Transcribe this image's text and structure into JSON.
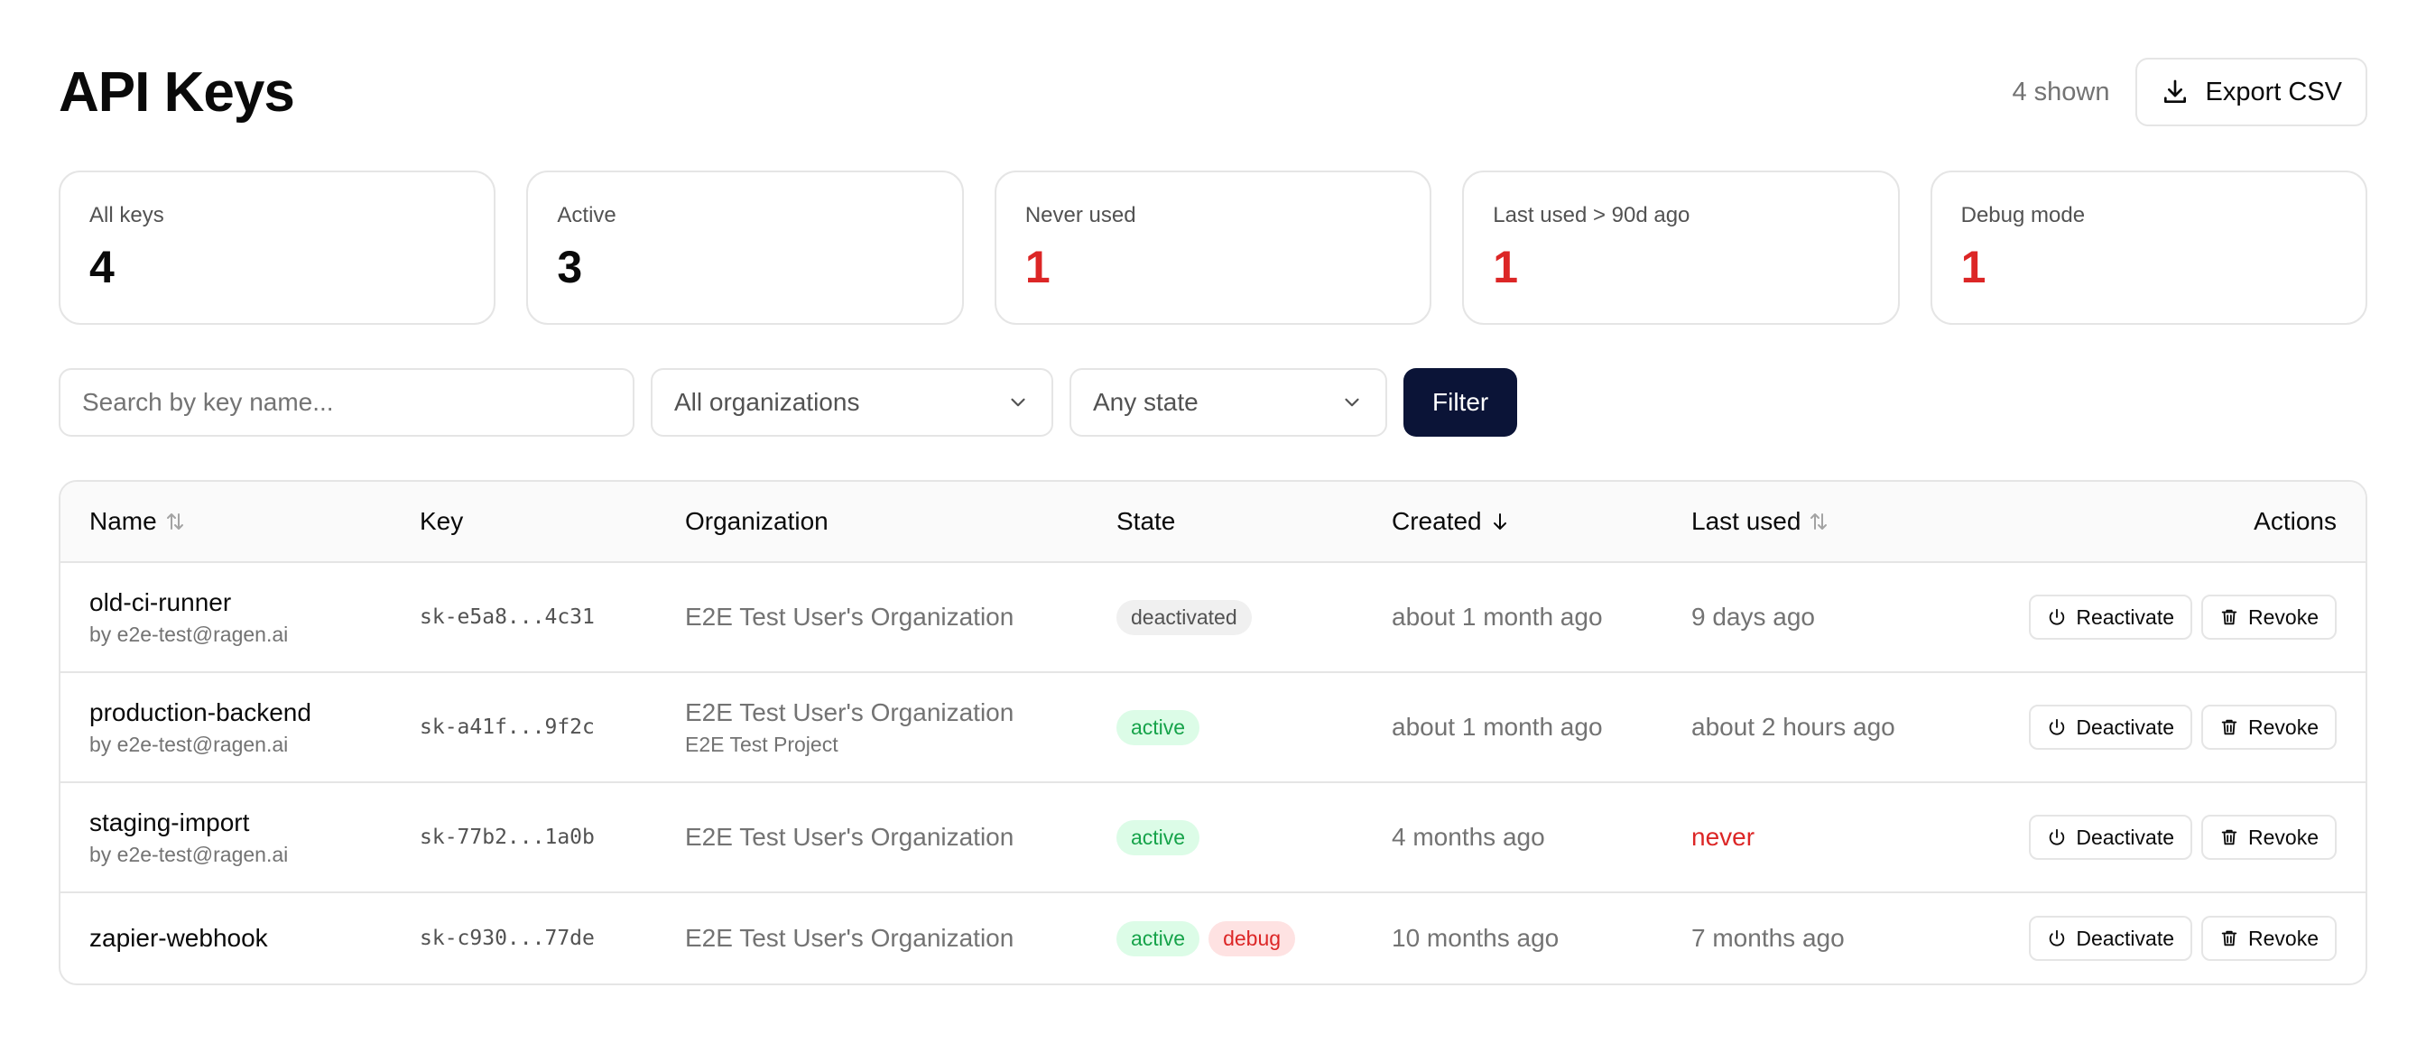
{
  "header": {
    "title": "API Keys",
    "shown": "4 shown",
    "export_label": "Export CSV"
  },
  "stats": [
    {
      "label": "All keys",
      "value": "4",
      "alert": false
    },
    {
      "label": "Active",
      "value": "3",
      "alert": false
    },
    {
      "label": "Never used",
      "value": "1",
      "alert": true
    },
    {
      "label": "Last used > 90d ago",
      "value": "1",
      "alert": true
    },
    {
      "label": "Debug mode",
      "value": "1",
      "alert": true
    }
  ],
  "filters": {
    "search_placeholder": "Search by key name...",
    "org_select": "All organizations",
    "state_select": "Any state",
    "filter_label": "Filter"
  },
  "table": {
    "columns": {
      "name": "Name",
      "key": "Key",
      "organization": "Organization",
      "state": "State",
      "created": "Created",
      "last_used": "Last used",
      "actions": "Actions"
    },
    "rows": [
      {
        "name": "old-ci-runner",
        "owner": "by e2e-test@ragen.ai",
        "key": "sk-e5a8...4c31",
        "org": "E2E Test User's Organization",
        "project": "",
        "badges": [
          "deactivated"
        ],
        "created": "about 1 month ago",
        "last_used": "9 days ago",
        "toggle_label": "Reactivate",
        "revoke_label": "Revoke"
      },
      {
        "name": "production-backend",
        "owner": "by e2e-test@ragen.ai",
        "key": "sk-a41f...9f2c",
        "org": "E2E Test User's Organization",
        "project": "E2E Test Project",
        "badges": [
          "active"
        ],
        "created": "about 1 month ago",
        "last_used": "about 2 hours ago",
        "toggle_label": "Deactivate",
        "revoke_label": "Revoke"
      },
      {
        "name": "staging-import",
        "owner": "by e2e-test@ragen.ai",
        "key": "sk-77b2...1a0b",
        "org": "E2E Test User's Organization",
        "project": "",
        "badges": [
          "active"
        ],
        "created": "4 months ago",
        "last_used": "never",
        "toggle_label": "Deactivate",
        "revoke_label": "Revoke"
      },
      {
        "name": "zapier-webhook",
        "owner": "",
        "key": "sk-c930...77de",
        "org": "E2E Test User's Organization",
        "project": "",
        "badges": [
          "active",
          "debug"
        ],
        "created": "10 months ago",
        "last_used": "7 months ago",
        "toggle_label": "Deactivate",
        "revoke_label": "Revoke"
      }
    ]
  },
  "icons": {
    "export": "download-icon",
    "select": "chevron-down-icon",
    "sort_both": "sort-icon",
    "sort_desc": "arrow-down-icon",
    "toggle": "power-icon",
    "revoke": "trash-icon"
  },
  "colors": {
    "primary_button": "#0b1437",
    "alert_red": "#dc2626",
    "active_green": "#16a34a",
    "border": "#e5e5e5"
  }
}
